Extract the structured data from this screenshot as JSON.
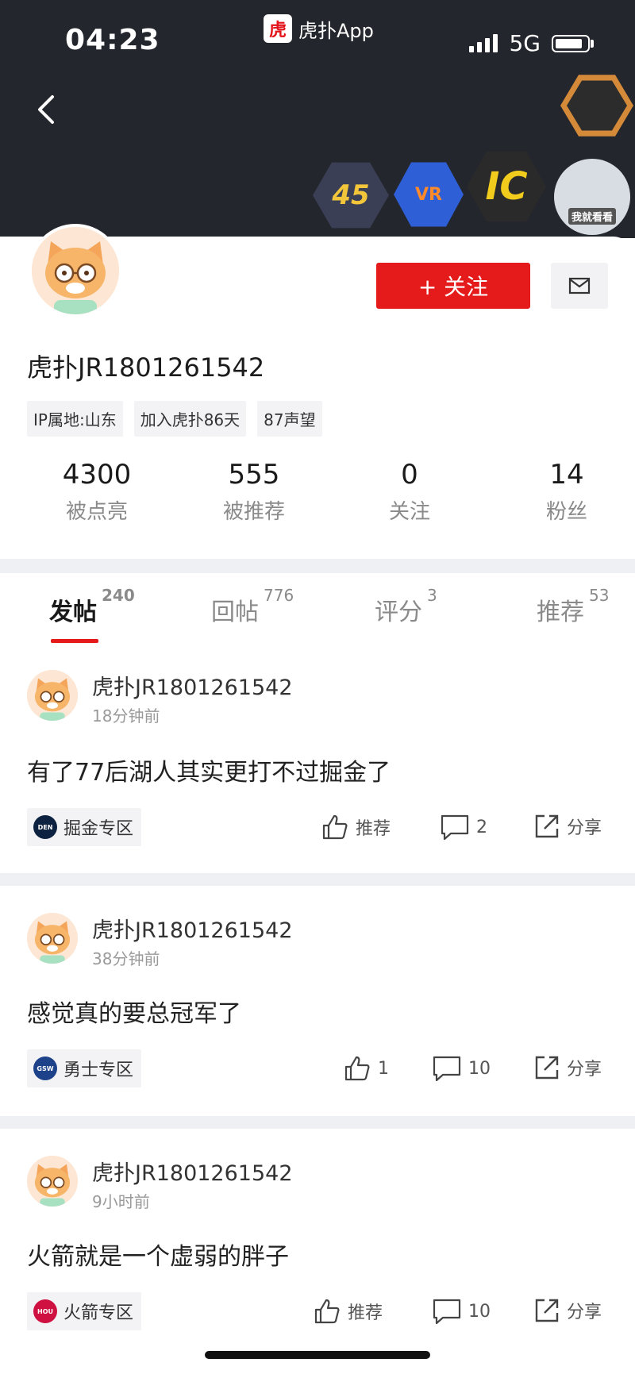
{
  "status_bar": {
    "time": "04:23",
    "app_name": "虎扑App",
    "network": "5G"
  },
  "header": {
    "badges": [
      "45",
      "VR",
      "IC",
      "我就看看"
    ]
  },
  "profile": {
    "follow_label": "+ 关注",
    "username": "虎扑JR1801261542",
    "tags": [
      "IP属地:山东",
      "加入虎扑86天",
      "87声望"
    ],
    "stats": [
      {
        "value": "4300",
        "label": "被点亮"
      },
      {
        "value": "555",
        "label": "被推荐"
      },
      {
        "value": "0",
        "label": "关注"
      },
      {
        "value": "14",
        "label": "粉丝"
      }
    ]
  },
  "tabs": [
    {
      "label": "发帖",
      "count": "240",
      "active": true
    },
    {
      "label": "回帖",
      "count": "776"
    },
    {
      "label": "评分",
      "count": "3"
    },
    {
      "label": "推荐",
      "count": "53"
    }
  ],
  "posts": [
    {
      "author": "虎扑JR1801261542",
      "time": "18分钟前",
      "text": "有了77后湖人其实更打不过掘金了",
      "zone": "掘金专区",
      "zone_abbr": "DEN",
      "zone_color": "#0d2240",
      "like": "推荐",
      "comments": "2",
      "share": "分享"
    },
    {
      "author": "虎扑JR1801261542",
      "time": "38分钟前",
      "text": "感觉真的要总冠军了",
      "zone": "勇士专区",
      "zone_abbr": "GSW",
      "zone_color": "#1d428a",
      "like": "1",
      "comments": "10",
      "share": "分享"
    },
    {
      "author": "虎扑JR1801261542",
      "time": "9小时前",
      "text": "火箭就是一个虚弱的胖子",
      "zone": "火箭专区",
      "zone_abbr": "HOU",
      "zone_color": "#ce1141",
      "like": "推荐",
      "comments": "10",
      "share": "分享"
    }
  ]
}
